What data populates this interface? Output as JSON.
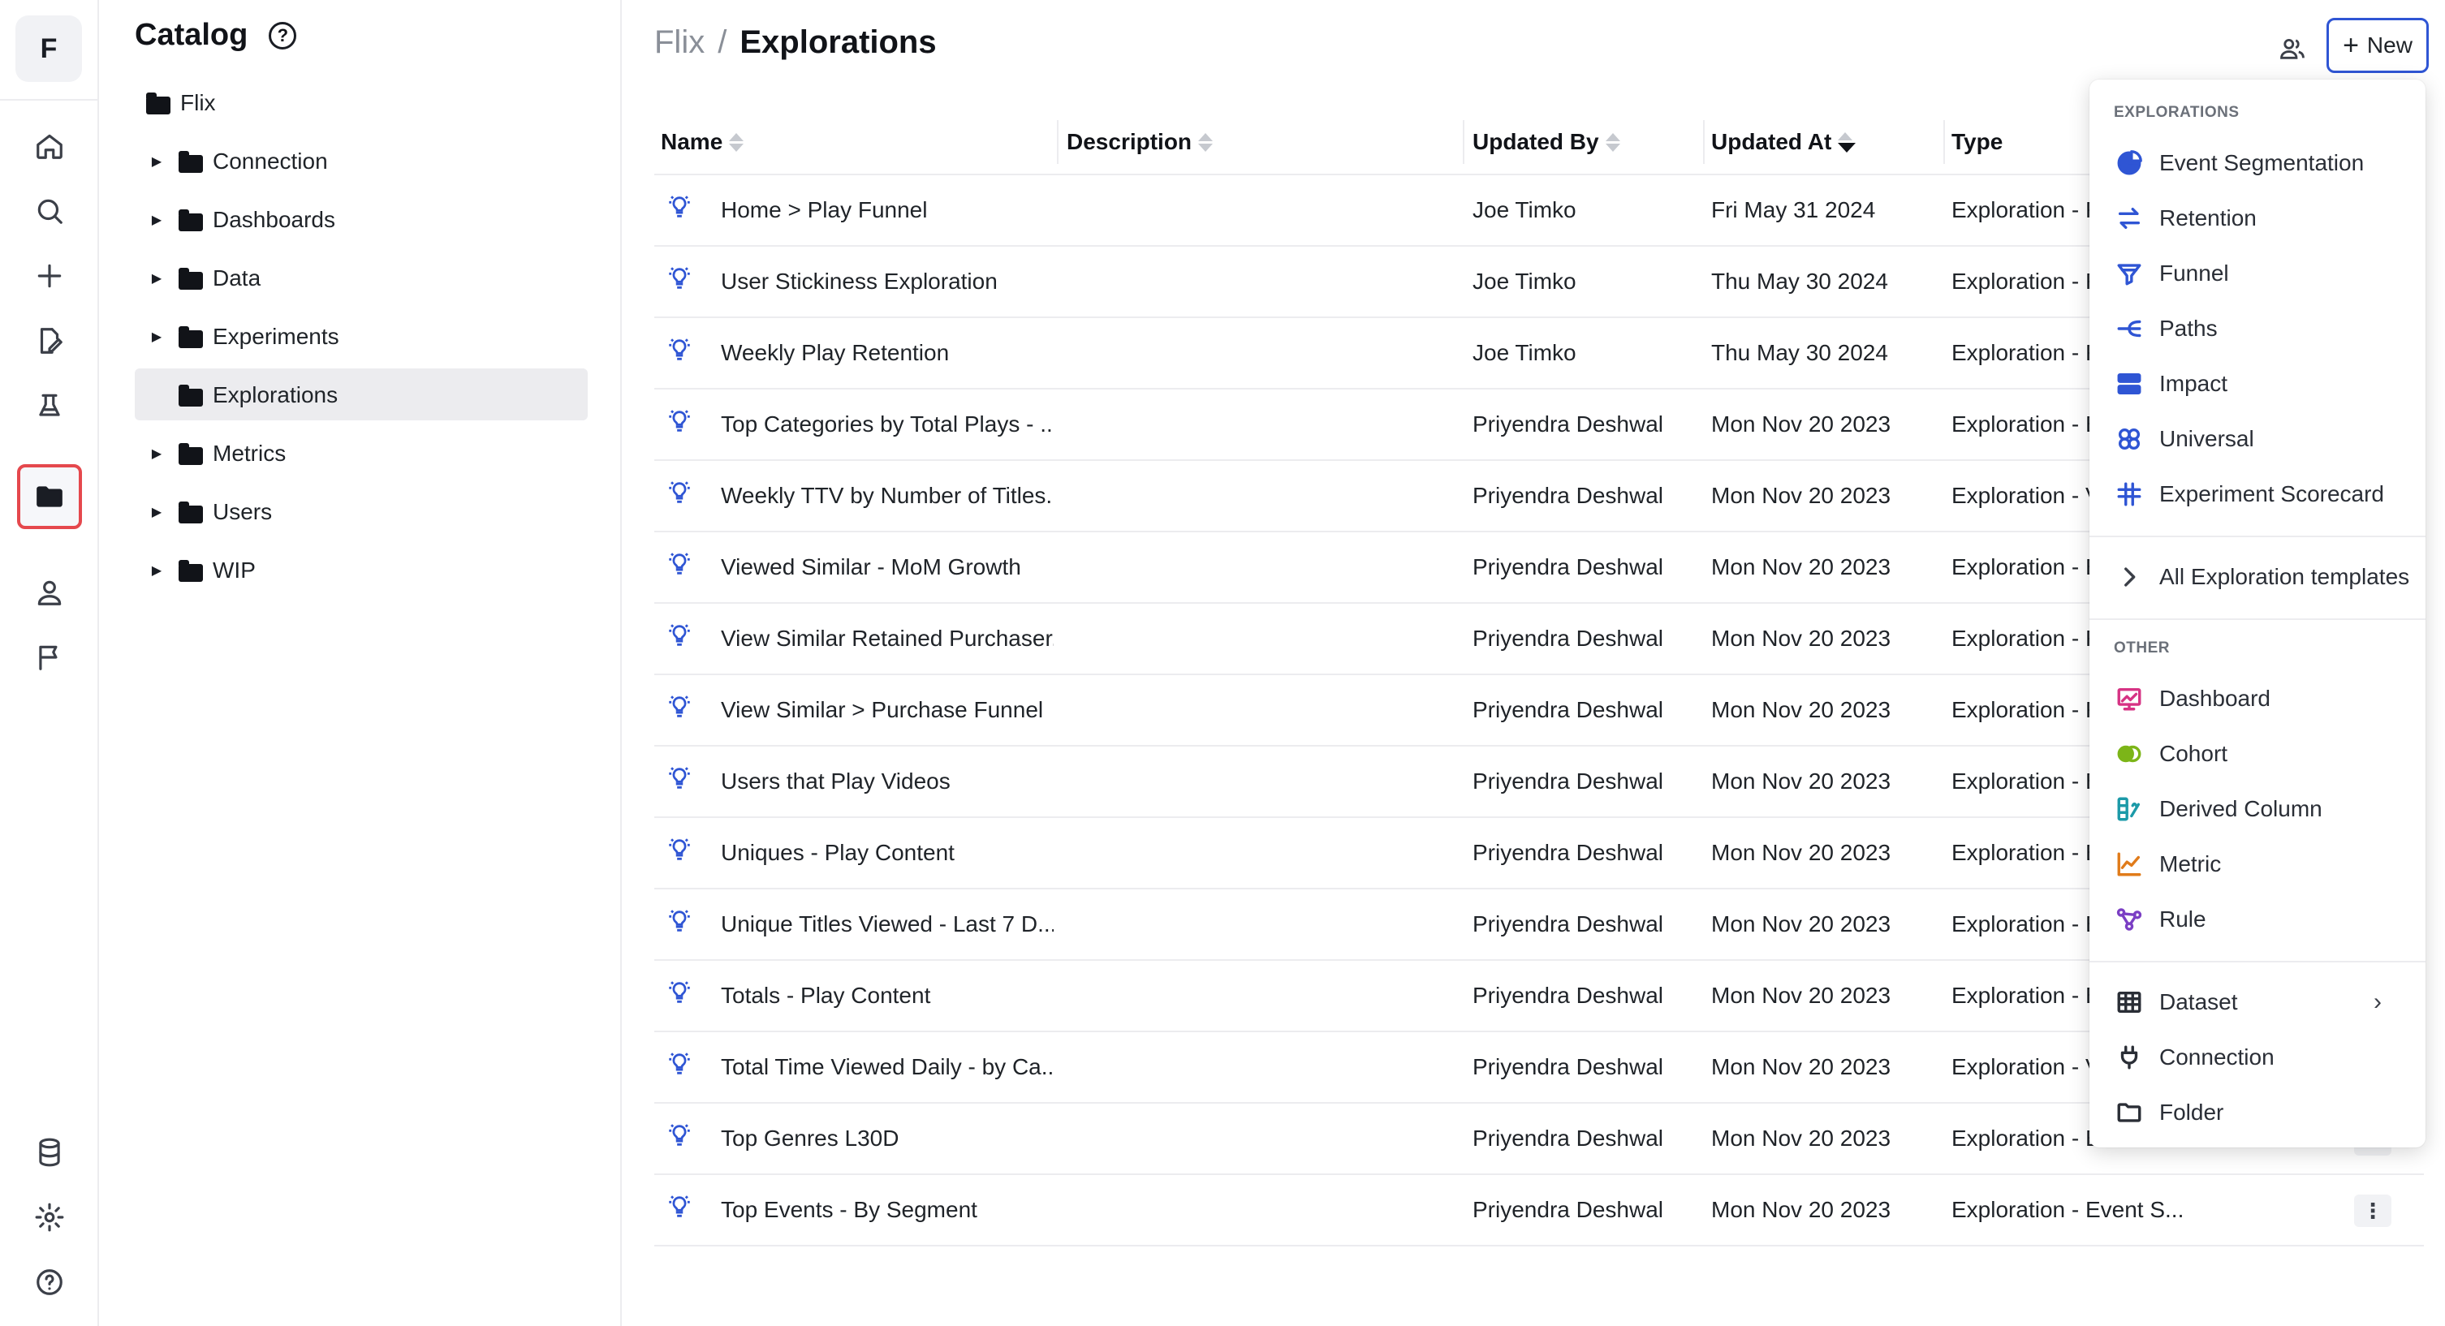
{
  "brand": {
    "letter": "F"
  },
  "catalog": {
    "title": "Catalog",
    "help_glyph": "?",
    "root": "Flix",
    "items": [
      {
        "label": "Connection",
        "expandable": true
      },
      {
        "label": "Dashboards",
        "expandable": true
      },
      {
        "label": "Data",
        "expandable": true
      },
      {
        "label": "Experiments",
        "expandable": true
      },
      {
        "label": "Explorations",
        "expandable": false,
        "selected": true
      },
      {
        "label": "Metrics",
        "expandable": true
      },
      {
        "label": "Users",
        "expandable": true
      },
      {
        "label": "WIP",
        "expandable": true
      }
    ]
  },
  "breadcrumb": {
    "parent": "Flix",
    "separator": "/",
    "current": "Explorations"
  },
  "header": {
    "new_label": "New",
    "new_icon": "+"
  },
  "table": {
    "columns": {
      "name": "Name",
      "description": "Description",
      "updated_by": "Updated By",
      "updated_at": "Updated At",
      "type": "Type"
    },
    "rows": [
      {
        "name": "Home > Play Funnel",
        "updated_by": "Joe Timko",
        "updated_at": "Fri May 31 2024",
        "type": "Exploration - F"
      },
      {
        "name": "User Stickiness Exploration",
        "updated_by": "Joe Timko",
        "updated_at": "Thu May 30 2024",
        "type": "Exploration - F"
      },
      {
        "name": "Weekly Play Retention",
        "updated_by": "Joe Timko",
        "updated_at": "Thu May 30 2024",
        "type": "Exploration - F"
      },
      {
        "name": "Top Categories by Total Plays - ...",
        "updated_by": "Priyendra Deshwal",
        "updated_at": "Mon Nov 20 2023",
        "type": "Exploration - E"
      },
      {
        "name": "Weekly TTV by Number of Titles...",
        "updated_by": "Priyendra Deshwal",
        "updated_at": "Mon Nov 20 2023",
        "type": "Exploration - V"
      },
      {
        "name": "Viewed Similar - MoM Growth",
        "updated_by": "Priyendra Deshwal",
        "updated_at": "Mon Nov 20 2023",
        "type": "Exploration - E"
      },
      {
        "name": "View Similar Retained Purchaser...",
        "updated_by": "Priyendra Deshwal",
        "updated_at": "Mon Nov 20 2023",
        "type": "Exploration - F"
      },
      {
        "name": "View Similar > Purchase Funnel",
        "updated_by": "Priyendra Deshwal",
        "updated_at": "Mon Nov 20 2023",
        "type": "Exploration - F"
      },
      {
        "name": "Users that Play Videos",
        "updated_by": "Priyendra Deshwal",
        "updated_at": "Mon Nov 20 2023",
        "type": "Exploration - E"
      },
      {
        "name": "Uniques - Play Content",
        "updated_by": "Priyendra Deshwal",
        "updated_at": "Mon Nov 20 2023",
        "type": "Exploration - E"
      },
      {
        "name": "Unique Titles Viewed - Last 7 D...",
        "updated_by": "Priyendra Deshwal",
        "updated_at": "Mon Nov 20 2023",
        "type": "Exploration - E"
      },
      {
        "name": "Totals - Play Content",
        "updated_by": "Priyendra Deshwal",
        "updated_at": "Mon Nov 20 2023",
        "type": "Exploration - E"
      },
      {
        "name": "Total Time Viewed Daily - by Ca...",
        "updated_by": "Priyendra Deshwal",
        "updated_at": "Mon Nov 20 2023",
        "type": "Exploration - V"
      },
      {
        "name": "Top Genres L30D",
        "updated_by": "Priyendra Deshwal",
        "updated_at": "Mon Nov 20 2023",
        "type": "Exploration - Event S..."
      },
      {
        "name": "Top Events - By Segment",
        "updated_by": "Priyendra Deshwal",
        "updated_at": "Mon Nov 20 2023",
        "type": "Exploration - Event S..."
      }
    ]
  },
  "menu": {
    "explorations_heading": "EXPLORATIONS",
    "explorations": [
      {
        "label": "Event Segmentation",
        "icon": "pie-chart-icon",
        "color": "#2f55d4"
      },
      {
        "label": "Retention",
        "icon": "arrows-swap-icon",
        "color": "#2f55d4"
      },
      {
        "label": "Funnel",
        "icon": "funnel-icon",
        "color": "#2f55d4"
      },
      {
        "label": "Paths",
        "icon": "paths-icon",
        "color": "#2f55d4"
      },
      {
        "label": "Impact",
        "icon": "impact-icon",
        "color": "#2f55d4"
      },
      {
        "label": "Universal",
        "icon": "universal-icon",
        "color": "#2f55d4"
      },
      {
        "label": "Experiment Scorecard",
        "icon": "scorecard-icon",
        "color": "#2f55d4"
      }
    ],
    "all_templates": "All Exploration templates",
    "other_heading": "OTHER",
    "other": [
      {
        "label": "Dashboard",
        "icon": "dashboard-icon",
        "color": "#d63384"
      },
      {
        "label": "Cohort",
        "icon": "cohort-icon",
        "color": "#7cb518"
      },
      {
        "label": "Derived Column",
        "icon": "derived-column-icon",
        "color": "#1c9aa8"
      },
      {
        "label": "Metric",
        "icon": "metric-icon",
        "color": "#e07b1a"
      },
      {
        "label": "Rule",
        "icon": "rule-icon",
        "color": "#7b3fc4"
      }
    ],
    "tail": [
      {
        "label": "Dataset",
        "icon": "table-grid-icon",
        "has_submenu": true
      },
      {
        "label": "Connection",
        "icon": "plug-icon"
      },
      {
        "label": "Folder",
        "icon": "folder-outline-icon"
      }
    ]
  }
}
